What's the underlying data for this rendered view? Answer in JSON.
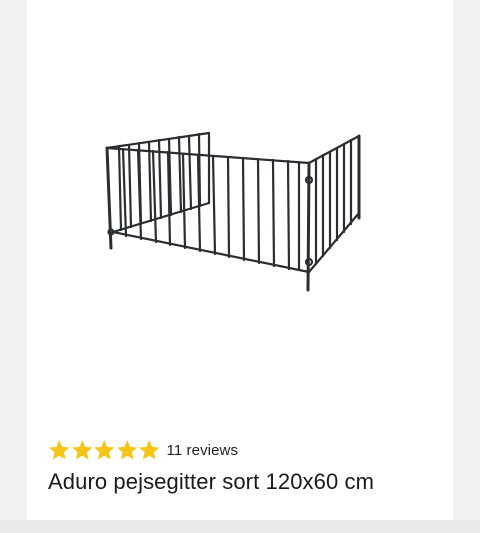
{
  "product": {
    "image_alt": "Aduro pejsegitter sort 120x60 cm",
    "rating": 5,
    "rating_max": 5,
    "reviews_label": "11 reviews",
    "title": "Aduro pejsegitter sort 120x60 cm"
  },
  "colors": {
    "star": "#f5c518",
    "title_text": "#1a1a1a",
    "page_bg": "#f2f2f2",
    "card_bg": "#ffffff",
    "product_metal": "#2a2e33"
  }
}
